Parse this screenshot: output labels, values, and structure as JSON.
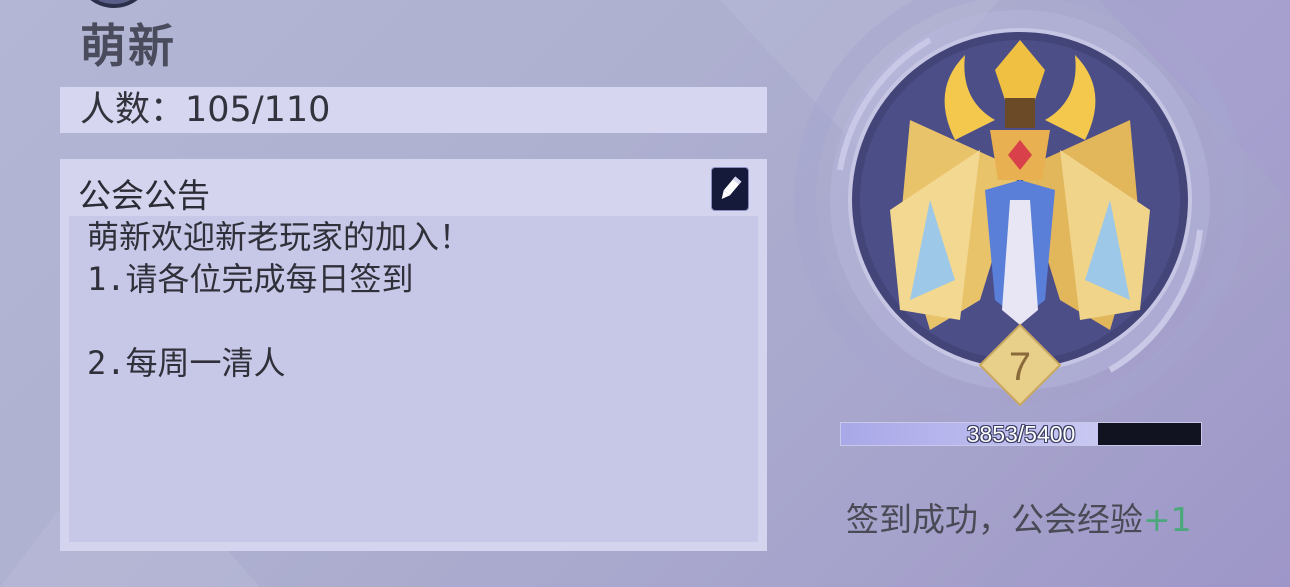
{
  "guild": {
    "name": "萌新",
    "members_label": "人数：",
    "members_value": "105/110"
  },
  "notice": {
    "title": "公会公告",
    "body": "萌新欢迎新老玩家的加入！\n1.请各位完成每日签到\n\n2.每周一清人",
    "edit_icon": "pencil-icon"
  },
  "emblem": {
    "icon": "winged-crown-emblem-icon",
    "level": "7"
  },
  "experience": {
    "text": "3853/5400",
    "current": 3853,
    "max": 5400
  },
  "checkin": {
    "message": "签到成功，公会经验",
    "gain": "+1"
  },
  "colors": {
    "gain_green": "#4ba87a",
    "exp_fill": "#b2b1ec"
  }
}
